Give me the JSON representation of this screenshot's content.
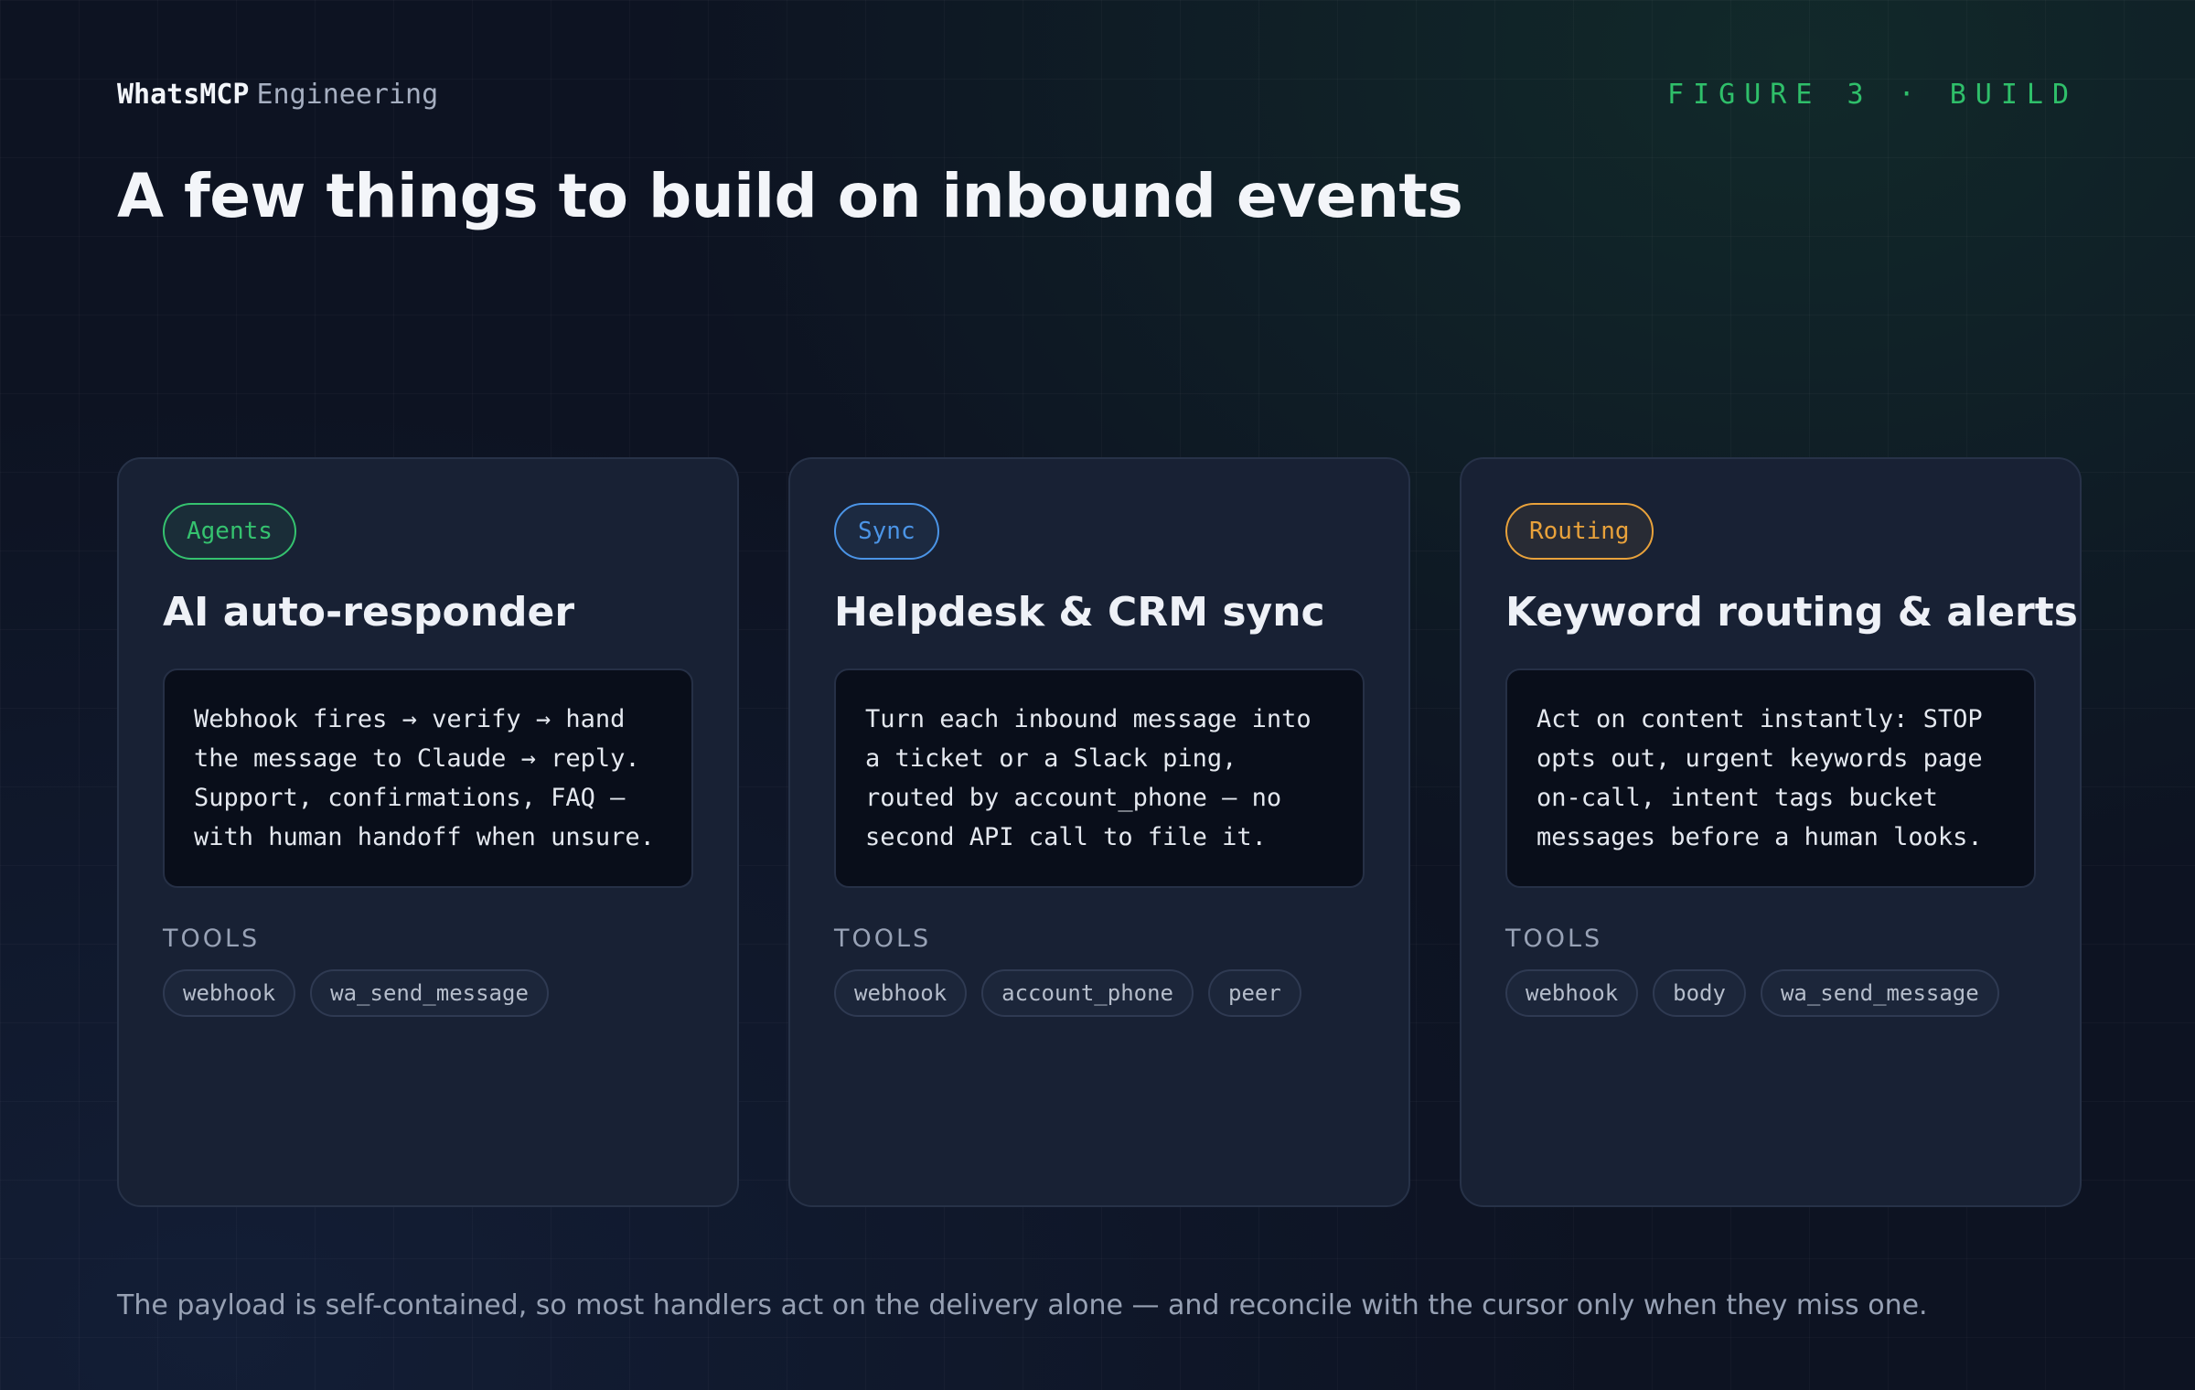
{
  "header": {
    "brand_name": "WhatsMCP",
    "brand_suffix": "Engineering",
    "figure_label": "FIGURE 3 · BUILD"
  },
  "title": "A few things to build on inbound events",
  "tools_label": "TOOLS",
  "cards": [
    {
      "tag": "Agents",
      "tag_color": "#35c26f",
      "title": "AI auto-responder",
      "description": "Webhook fires → verify → hand the message to Claude → reply. Support, confirmations, FAQ — with human handoff when unsure.",
      "tools": [
        "webhook",
        "wa_send_message"
      ]
    },
    {
      "tag": "Sync",
      "tag_color": "#4b94e6",
      "title": "Helpdesk & CRM sync",
      "description": "Turn each inbound message into a ticket or a Slack ping, routed by account_phone — no second API call to file it.",
      "tools": [
        "webhook",
        "account_phone",
        "peer"
      ]
    },
    {
      "tag": "Routing",
      "tag_color": "#e9a23b",
      "title": "Keyword routing & alerts",
      "description": "Act on content instantly: STOP opts out, urgent keywords page on-call, intent tags bucket messages before a human looks.",
      "tools": [
        "webhook",
        "body",
        "wa_send_message"
      ]
    }
  ],
  "footer": "The payload is self-contained, so most handlers act on the delivery alone — and reconcile with the cursor only when they miss one."
}
